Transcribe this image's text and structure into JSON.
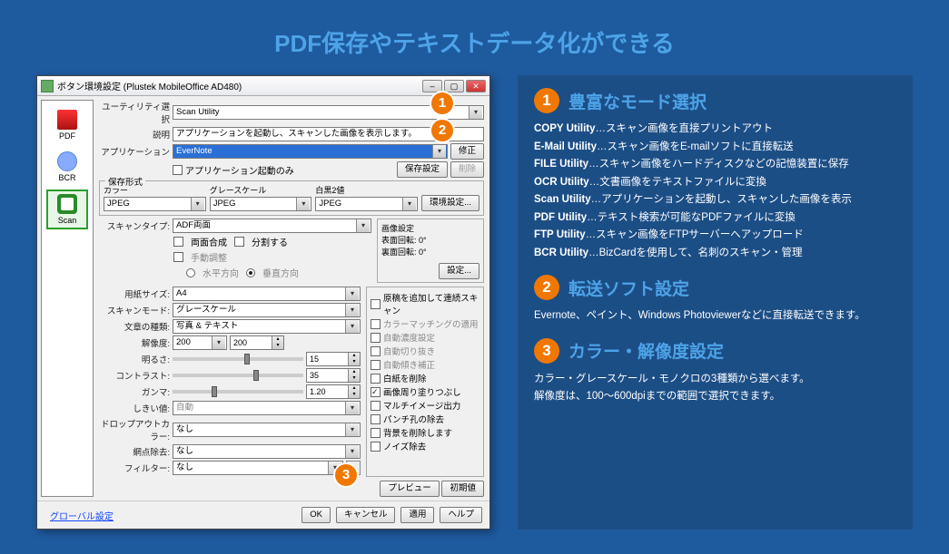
{
  "page_title": "PDF保存やテキストデータ化ができる",
  "window": {
    "title": "ボタン環境設定 (Plustek MobileOffice AD480)",
    "sidebar": [
      {
        "label": "PDF"
      },
      {
        "label": "BCR"
      },
      {
        "label": "Scan"
      }
    ],
    "utility_label": "ユーティリティ選択",
    "utility_value": "Scan Utility",
    "desc_label": "説明",
    "desc_value": "アプリケーションを起動し、スキャンした画像を表示します。",
    "app_label": "アプリケーション",
    "app_value": "EverNote",
    "edit_btn": "修正",
    "del_btn": "削除",
    "app_only_label": "アプリケーション起動のみ",
    "save_set_btn": "保存設定",
    "save_format_title": "保存形式",
    "color_lbl": "カラー",
    "gray_lbl": "グレースケール",
    "bw_lbl": "白黒2値",
    "color_val": "JPEG",
    "gray_val": "JPEG",
    "bw_val": "JPEG",
    "env_set_btn": "環境設定...",
    "scantype_label": "スキャンタイプ:",
    "scantype_value": "ADF両面",
    "merge_label": "両面合成",
    "split_label": "分割する",
    "manual_label": "手動調整",
    "horiz_label": "水平方向",
    "vert_label": "垂直方向",
    "imgset_title": "画像設定",
    "front_rot_lbl": "表面回転:",
    "front_rot_val": "0°",
    "back_rot_lbl": "裏面回転:",
    "back_rot_val": "0°",
    "set_btn": "設定...",
    "paper_label": "用紙サイズ:",
    "paper_value": "A4",
    "scanmode_label": "スキャンモード:",
    "scanmode_value": "グレースケール",
    "doctype_label": "文章の種類:",
    "doctype_value": "写真 & テキスト",
    "res_label": "解像度:",
    "res_value": "200",
    "bright_label": "明るさ:",
    "bright_value": "15",
    "contrast_label": "コントラスト:",
    "contrast_value": "35",
    "gamma_label": "ガンマ:",
    "gamma_value": "1.20",
    "thresh_label": "しきい値:",
    "thresh_value": "自動",
    "dropout_label": "ドロップアウトカラー:",
    "dropout_value": "なし",
    "moire_label": "網点除去:",
    "moire_value": "なし",
    "filter_label": "フィルター:",
    "filter_value": "なし",
    "cont_scan_label": "原稿を追加して連続スキャン",
    "color_match_label": "カラーマッチングの適用",
    "auto_dens_label": "自動濃度設定",
    "auto_crop_label": "自動切り抜き",
    "auto_skew_label": "自動傾き補正",
    "blank_label": "白紙を削除",
    "fill_label": "画像周り塗りつぶし",
    "multi_label": "マルチイメージ出力",
    "punch_label": "パンチ孔の除去",
    "bg_label": "背景を削除します",
    "noise_label": "ノイズ除去",
    "preview_btn": "プレビュー",
    "default_btn": "初期値",
    "global_link": "グローバル設定",
    "ok_btn": "OK",
    "cancel_btn": "キャンセル",
    "apply_btn": "適用",
    "help_btn": "ヘルプ"
  },
  "info": {
    "s1_title": "豊富なモード選択",
    "s1_lines": [
      [
        "COPY Utility",
        "…スキャン画像を直接プリントアウト"
      ],
      [
        "E-Mail Utility",
        "…スキャン画像をE-mailソフトに直接転送"
      ],
      [
        "FILE Utility",
        "…スキャン画像をハードディスクなどの記憶装置に保存"
      ],
      [
        "OCR Utility",
        "…文書画像をテキストファイルに変換"
      ],
      [
        "Scan Utility",
        "…アプリケーションを起動し、スキャンした画像を表示"
      ],
      [
        "PDF Utility",
        "…テキスト検索が可能なPDFファイルに変換"
      ],
      [
        "FTP Utility",
        "…スキャン画像をFTPサーバーへアップロード"
      ],
      [
        "BCR Utility",
        "…BizCardを使用して、名刺のスキャン・管理"
      ]
    ],
    "s2_title": "転送ソフト設定",
    "s2_body": "Evernote、ペイント、Windows Photoviewerなどに直接転送できます。",
    "s3_title": "カラー・解像度設定",
    "s3_body1": "カラー・グレースケール・モノクロの3種類から選べます。",
    "s3_body2": "解像度は、100〜600dpiまでの範囲で選択できます。"
  }
}
